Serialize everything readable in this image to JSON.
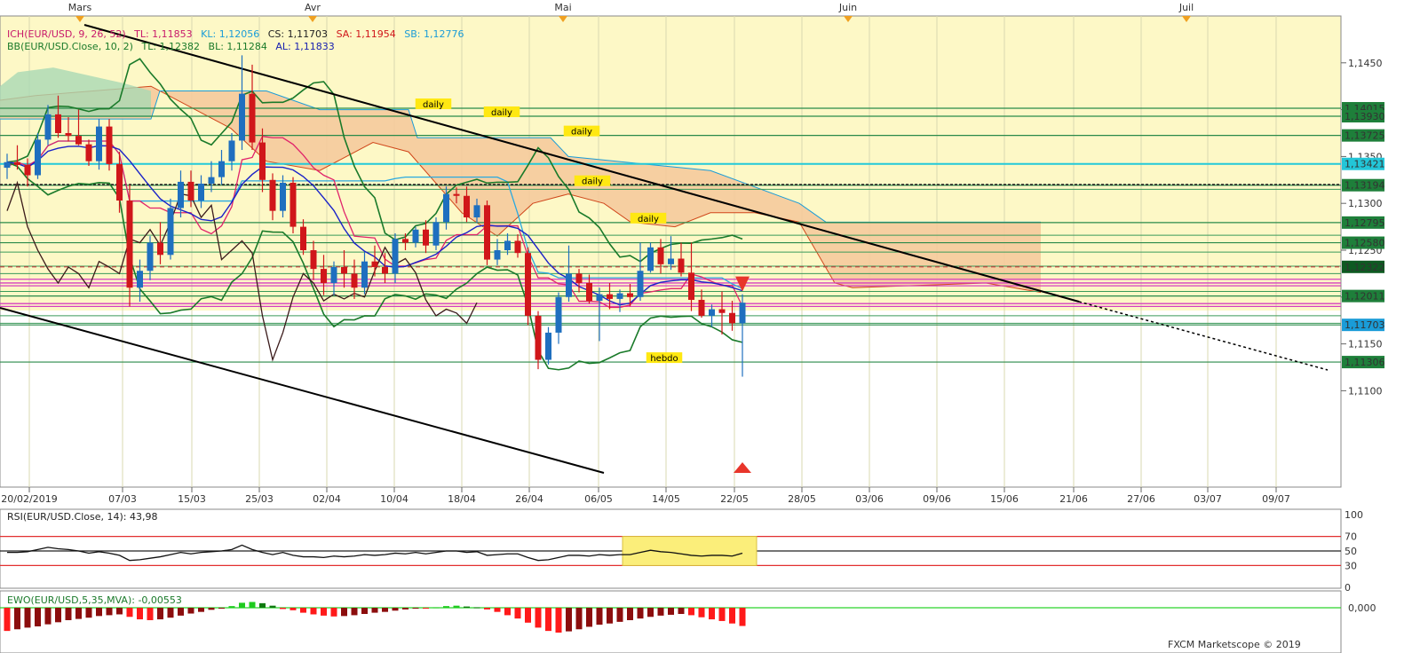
{
  "top_axis": {
    "months": [
      "Mars",
      "Avr",
      "Mai",
      "Juin",
      "Juil"
    ]
  },
  "main_panel": {
    "indicator_ich": {
      "name": "ICH(EUR/USD, 9, 26, 52)",
      "tl": "TL: 1,11853",
      "kl": "KL: 1,12056",
      "cs": "CS: 1,11703",
      "sa": "SA: 1,11954",
      "sb": "SB: 1,12776"
    },
    "indicator_bb": {
      "name": "BB(EUR/USD.Close, 10, 2)",
      "tl": "TL: 1,12382",
      "bl": "BL: 1,11284",
      "al": "AL: 1,11833"
    },
    "level_labels": [
      "daily",
      "daily",
      "daily",
      "daily",
      "daily",
      "hebdo"
    ],
    "price_badges": [
      "1,14015",
      "1,13930",
      "1,13725",
      "1,13421",
      "1,13194",
      "1,12795",
      "1,12580",
      "1,12322",
      "1,12011",
      "1,11703",
      "1,11306"
    ],
    "y_ticks": [
      "1,1450",
      "1,1400",
      "1,1350",
      "1,1300",
      "1,1250",
      "1,1200",
      "1,1150",
      "1,1100"
    ],
    "x_ticks": [
      "20/02/2019",
      "07/03",
      "15/03",
      "25/03",
      "02/04",
      "10/04",
      "18/04",
      "26/04",
      "06/05",
      "14/05",
      "22/05",
      "28/05",
      "03/06",
      "09/06",
      "15/06",
      "21/06",
      "27/06",
      "03/07",
      "09/07"
    ]
  },
  "rsi_panel": {
    "label": "RSI(EUR/USD.Close, 14): 43,98",
    "levels": [
      "100",
      "70",
      "50",
      "30",
      "0"
    ]
  },
  "ewo_panel": {
    "label": "EWO(EUR/USD,5,35,MVA): -0,00553",
    "zero_label": "0,000"
  },
  "watermark": "FXCM Marketscope © 2019",
  "colors": {
    "bull": "#1f6fbf",
    "bear": "#d0161a",
    "cloud": "#f4c89a",
    "bg_zone": "#fdf8c6",
    "bb": "#1a7a2a",
    "tenkan": "#e0236b",
    "kijun": "#29a9e0",
    "badge_green": "#1e7f3a",
    "badge_blue": "#1a9cd8"
  },
  "chart_data": [
    {
      "type": "candlestick",
      "title": "EUR/USD",
      "x_start": "20/02/2019",
      "ylim": [
        1.108,
        1.15
      ],
      "candles": [
        [
          1.1338,
          1.1353,
          1.1326,
          1.1344
        ],
        [
          1.1344,
          1.1362,
          1.1336,
          1.1341
        ],
        [
          1.1341,
          1.1348,
          1.1318,
          1.133
        ],
        [
          1.133,
          1.1375,
          1.1326,
          1.1368
        ],
        [
          1.1368,
          1.1405,
          1.1362,
          1.1395
        ],
        [
          1.1395,
          1.1415,
          1.137,
          1.1375
        ],
        [
          1.1375,
          1.1392,
          1.1366,
          1.1372
        ],
        [
          1.1372,
          1.14,
          1.1362,
          1.1363
        ],
        [
          1.1363,
          1.1368,
          1.134,
          1.1345
        ],
        [
          1.1345,
          1.139,
          1.1336,
          1.1382
        ],
        [
          1.1382,
          1.139,
          1.1335,
          1.1342
        ],
        [
          1.1342,
          1.1355,
          1.129,
          1.1303
        ],
        [
          1.1303,
          1.132,
          1.119,
          1.121
        ],
        [
          1.121,
          1.124,
          1.1195,
          1.1228
        ],
        [
          1.1228,
          1.1265,
          1.1218,
          1.1258
        ],
        [
          1.1258,
          1.128,
          1.1235,
          1.1245
        ],
        [
          1.1245,
          1.1305,
          1.124,
          1.1295
        ],
        [
          1.1295,
          1.1335,
          1.1285,
          1.1323
        ],
        [
          1.1323,
          1.1335,
          1.1296,
          1.1303
        ],
        [
          1.1303,
          1.133,
          1.1295,
          1.1321
        ],
        [
          1.1321,
          1.1345,
          1.1312,
          1.1328
        ],
        [
          1.1328,
          1.1357,
          1.132,
          1.1345
        ],
        [
          1.1345,
          1.1375,
          1.1335,
          1.1367
        ],
        [
          1.1367,
          1.1458,
          1.1357,
          1.1417
        ],
        [
          1.1417,
          1.1448,
          1.1357,
          1.1365
        ],
        [
          1.1365,
          1.138,
          1.1312,
          1.1325
        ],
        [
          1.1325,
          1.1332,
          1.1282,
          1.1292
        ],
        [
          1.1292,
          1.133,
          1.1285,
          1.1322
        ],
        [
          1.1322,
          1.1328,
          1.1268,
          1.1275
        ],
        [
          1.1275,
          1.1283,
          1.1245,
          1.125
        ],
        [
          1.125,
          1.126,
          1.1218,
          1.123
        ],
        [
          1.123,
          1.1245,
          1.1202,
          1.1215
        ],
        [
          1.1215,
          1.1238,
          1.1202,
          1.1232
        ],
        [
          1.1232,
          1.125,
          1.121,
          1.1225
        ],
        [
          1.1225,
          1.124,
          1.1198,
          1.121
        ],
        [
          1.121,
          1.1248,
          1.1203,
          1.1238
        ],
        [
          1.1238,
          1.1255,
          1.1222,
          1.1232
        ],
        [
          1.1232,
          1.1247,
          1.1215,
          1.1225
        ],
        [
          1.1225,
          1.1268,
          1.1215,
          1.1262
        ],
        [
          1.1262,
          1.1268,
          1.125,
          1.1258
        ],
        [
          1.1258,
          1.1275,
          1.1253,
          1.1272
        ],
        [
          1.1272,
          1.1282,
          1.1247,
          1.1255
        ],
        [
          1.1255,
          1.1285,
          1.125,
          1.128
        ],
        [
          1.128,
          1.1318,
          1.1272,
          1.131
        ],
        [
          1.131,
          1.1317,
          1.13,
          1.1308
        ],
        [
          1.1308,
          1.1318,
          1.128,
          1.1285
        ],
        [
          1.1285,
          1.1305,
          1.1279,
          1.1298
        ],
        [
          1.1298,
          1.1303,
          1.1234,
          1.124
        ],
        [
          1.124,
          1.1262,
          1.1234,
          1.125
        ],
        [
          1.125,
          1.1268,
          1.1245,
          1.126
        ],
        [
          1.126,
          1.1267,
          1.1242,
          1.1247
        ],
        [
          1.1247,
          1.1253,
          1.117,
          1.118
        ],
        [
          1.118,
          1.1185,
          1.1123,
          1.1133
        ],
        [
          1.1133,
          1.1168,
          1.1128,
          1.1162
        ],
        [
          1.1162,
          1.1205,
          1.115,
          1.12
        ],
        [
          1.12,
          1.1255,
          1.1195,
          1.1225
        ],
        [
          1.1225,
          1.123,
          1.1205,
          1.1215
        ],
        [
          1.1215,
          1.1224,
          1.1193,
          1.1196
        ],
        [
          1.1196,
          1.121,
          1.1153,
          1.1203
        ],
        [
          1.1203,
          1.1215,
          1.1187,
          1.1198
        ],
        [
          1.1198,
          1.1208,
          1.1184,
          1.1204
        ],
        [
          1.1204,
          1.1214,
          1.119,
          1.12
        ],
        [
          1.12,
          1.1258,
          1.1196,
          1.1228
        ],
        [
          1.1228,
          1.1258,
          1.1226,
          1.1253
        ],
        [
          1.1253,
          1.1262,
          1.1225,
          1.1235
        ],
        [
          1.1235,
          1.1265,
          1.1229,
          1.1241
        ],
        [
          1.1241,
          1.1258,
          1.1222,
          1.1226
        ],
        [
          1.1226,
          1.1258,
          1.1185,
          1.1197
        ],
        [
          1.1197,
          1.1208,
          1.1178,
          1.118
        ],
        [
          1.118,
          1.1192,
          1.1168,
          1.1187
        ],
        [
          1.1187,
          1.1206,
          1.116,
          1.1183
        ],
        [
          1.1183,
          1.1196,
          1.1164,
          1.1172
        ],
        [
          1.1172,
          1.1203,
          1.1115,
          1.1194
        ]
      ]
    },
    {
      "type": "line",
      "title": "RSI(EUR/USD.Close, 14)",
      "ylim": [
        0,
        100
      ],
      "reference_lines": [
        30,
        50,
        70
      ],
      "values": [
        48,
        48,
        49,
        52,
        55,
        53,
        52,
        50,
        47,
        49,
        47,
        44,
        37,
        38,
        40,
        42,
        45,
        48,
        46,
        48,
        49,
        50,
        52,
        58,
        52,
        48,
        45,
        48,
        44,
        42,
        42,
        41,
        43,
        42,
        43,
        45,
        44,
        45,
        47,
        46,
        48,
        46,
        48,
        50,
        50,
        48,
        49,
        44,
        45,
        46,
        46,
        41,
        37,
        38,
        41,
        44,
        44,
        43,
        45,
        44,
        45,
        45,
        48,
        51,
        49,
        48,
        46,
        44,
        43,
        44,
        44,
        43,
        47
      ]
    },
    {
      "type": "bar",
      "title": "EWO(EUR/USD,5,35,MVA)",
      "reference_lines": [
        0
      ],
      "values": [
        -0.0056,
        -0.0052,
        -0.0048,
        -0.0045,
        -0.004,
        -0.0035,
        -0.003,
        -0.0027,
        -0.0024,
        -0.002,
        -0.0018,
        -0.0016,
        -0.0022,
        -0.0028,
        -0.003,
        -0.0028,
        -0.0024,
        -0.0019,
        -0.0014,
        -0.001,
        -0.0005,
        -0.0002,
        0.0004,
        0.0012,
        0.0014,
        0.0011,
        0.0005,
        -0.0003,
        -0.0006,
        -0.0012,
        -0.0016,
        -0.0019,
        -0.0021,
        -0.002,
        -0.0018,
        -0.0015,
        -0.0012,
        -0.001,
        -0.0007,
        -0.0004,
        -0.0002,
        -0.0002,
        0.0001,
        0.0004,
        0.0005,
        0.0003,
        0.0001,
        -0.0004,
        -0.001,
        -0.0018,
        -0.0026,
        -0.0036,
        -0.0048,
        -0.0056,
        -0.006,
        -0.0057,
        -0.0052,
        -0.0046,
        -0.0041,
        -0.0038,
        -0.0034,
        -0.003,
        -0.0026,
        -0.0022,
        -0.0019,
        -0.0017,
        -0.0015,
        -0.0018,
        -0.0023,
        -0.0028,
        -0.0032,
        -0.0038,
        -0.0044
      ]
    }
  ]
}
